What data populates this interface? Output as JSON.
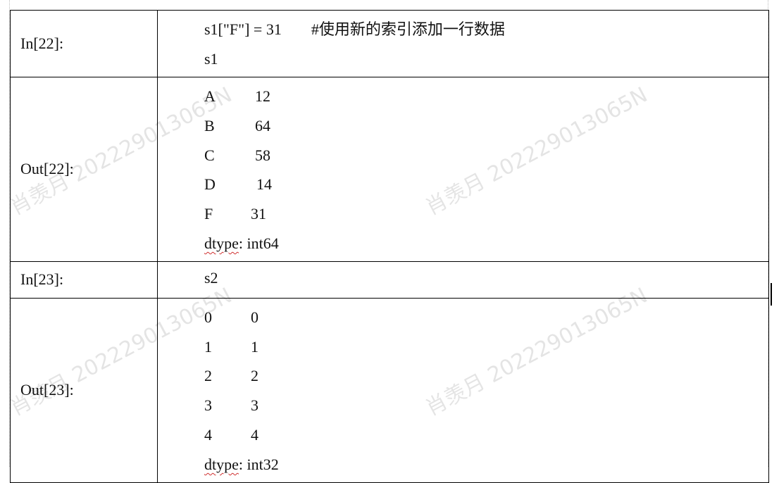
{
  "cells": [
    {
      "type": "in",
      "label": "In[22]:",
      "code": "s1[\"F\"] = 31",
      "comment": "#使用新的索引添加一行数据",
      "line2": "s1"
    },
    {
      "type": "out",
      "label": "Out[22]:",
      "rows": [
        [
          "A",
          "12"
        ],
        [
          "B",
          "64"
        ],
        [
          "C",
          "58"
        ],
        [
          "D",
          "14"
        ],
        [
          "F",
          "31"
        ]
      ],
      "dtype_word": "dtype",
      "dtype_rest": ": int64"
    },
    {
      "type": "in",
      "label": "In[23]:",
      "code": "s2"
    },
    {
      "type": "out",
      "label": "Out[23]:",
      "rows": [
        [
          "0",
          "0"
        ],
        [
          "1",
          "1"
        ],
        [
          "2",
          "2"
        ],
        [
          "3",
          "3"
        ],
        [
          "4",
          "4"
        ]
      ],
      "dtype_word": "dtype",
      "dtype_rest": ": int32"
    }
  ],
  "watermark": "肖羡月 202229013065N"
}
